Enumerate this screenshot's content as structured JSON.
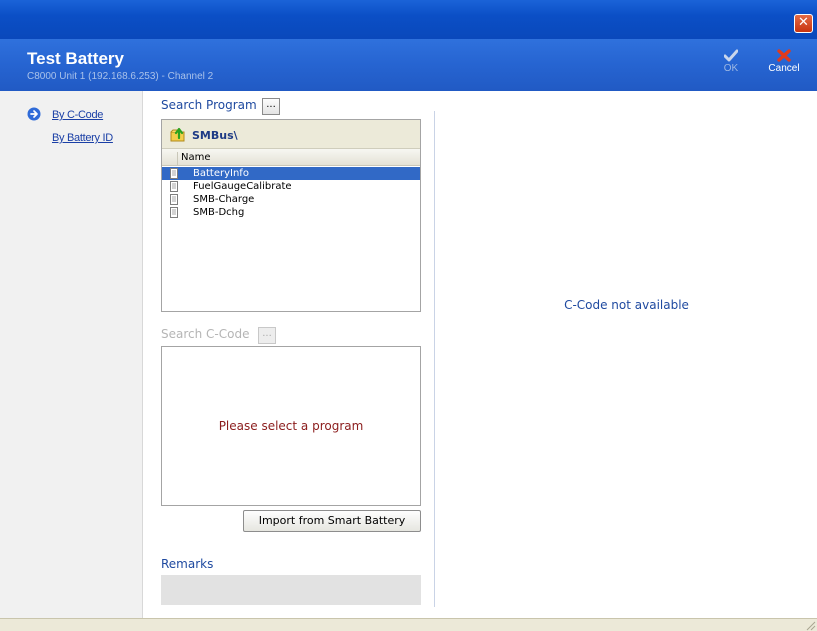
{
  "window": {
    "close_icon": "close-icon"
  },
  "header": {
    "title": "Test Battery",
    "subtitle": "C8000 Unit 1 (192.168.6.253) - Channel 2",
    "ok_label": "OK",
    "cancel_label": "Cancel"
  },
  "sidebar": {
    "items": [
      {
        "label": "By C-Code",
        "active": true
      },
      {
        "label": "By Battery ID",
        "active": false
      }
    ]
  },
  "program": {
    "search_label": "Search Program",
    "browse_label": "...",
    "path": "SMBus\\",
    "column_header": "Name",
    "items": [
      "BatteryInfo",
      "FuelGaugeCalibrate",
      "SMB-Charge",
      "SMB-Dchg"
    ],
    "selected_index": 0
  },
  "ccode": {
    "search_label": "Search C-Code",
    "browse_label": "...",
    "placeholder_message": "Please select a program",
    "not_available_message": "C-Code not available"
  },
  "actions": {
    "import_label": "Import from Smart Battery"
  },
  "remarks": {
    "label": "Remarks",
    "value": ""
  },
  "colors": {
    "title_bar": "#0b4fc6",
    "header": "#2664d1",
    "selection": "#3169c6",
    "accent_text": "#1f4aa0",
    "message_text": "#8b1c1c"
  }
}
